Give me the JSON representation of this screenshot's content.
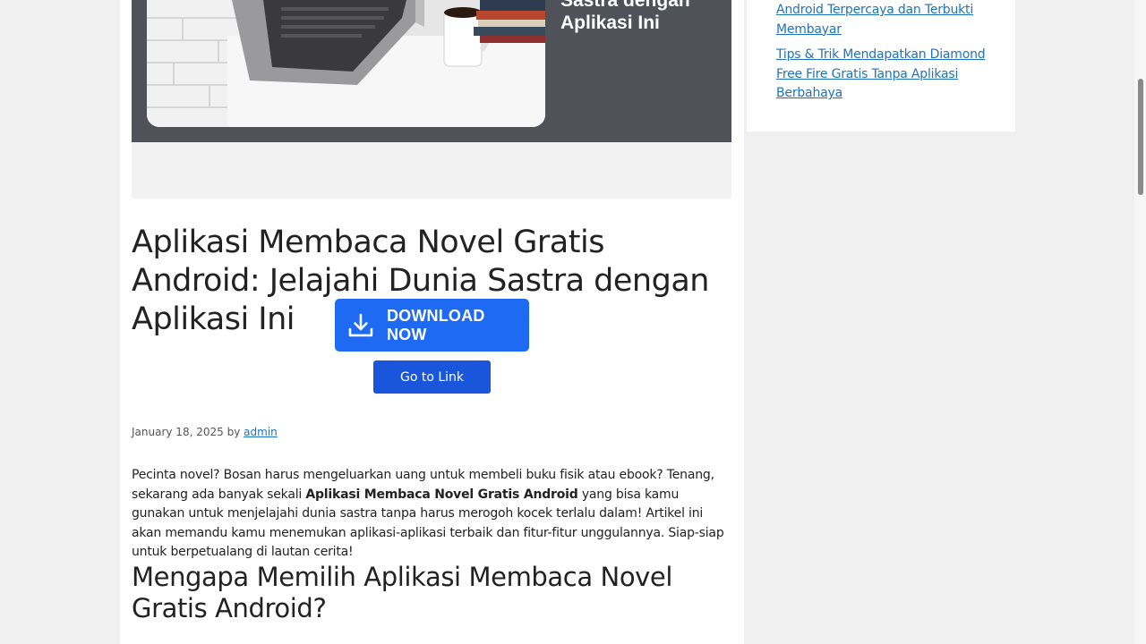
{
  "featured": {
    "overlay_lines": [
      "Sastra dengan",
      "Aplikasi Ini"
    ]
  },
  "post": {
    "title": "Aplikasi Membaca Novel Gratis Android: Jelajahi Dunia Sastra dengan Aplikasi Ini",
    "download_label": "DOWNLOAD NOW",
    "go_link_label": "Go to Link",
    "date": "January 18, 2025",
    "by": "by",
    "author": "admin",
    "intro_before": "Pecinta novel? Bosan harus mengeluarkan uang untuk membeli buku fisik atau ebook? Tenang, sekarang ada banyak sekali ",
    "intro_bold": "Aplikasi Membaca Novel Gratis Android",
    "intro_after": " yang bisa kamu gunakan untuk menjelajahi dunia sastra tanpa harus merogoh kocek terlalu dalam! Artikel ini akan memandu kamu menemukan aplikasi-aplikasi terbaik dan fitur-fitur unggulannya. Siap-siap untuk berpetualang di lautan cerita!",
    "section_heading": "Mengapa Memilih Aplikasi Membaca Novel Gratis Android?"
  },
  "sidebar": {
    "links": [
      {
        "lines": [
          "Android Terpercaya dan Terbukti",
          "Membayar"
        ]
      },
      {
        "lines": [
          "Tips & Trik Mendapatkan Diamond",
          "Free Fire Gratis Tanpa Aplikasi",
          "Berbahaya"
        ]
      }
    ]
  },
  "colors": {
    "download_button": "#1e6af2",
    "go_link_button": "#1a56db",
    "link": "#1e73be",
    "featured_bg": "#50525a"
  }
}
